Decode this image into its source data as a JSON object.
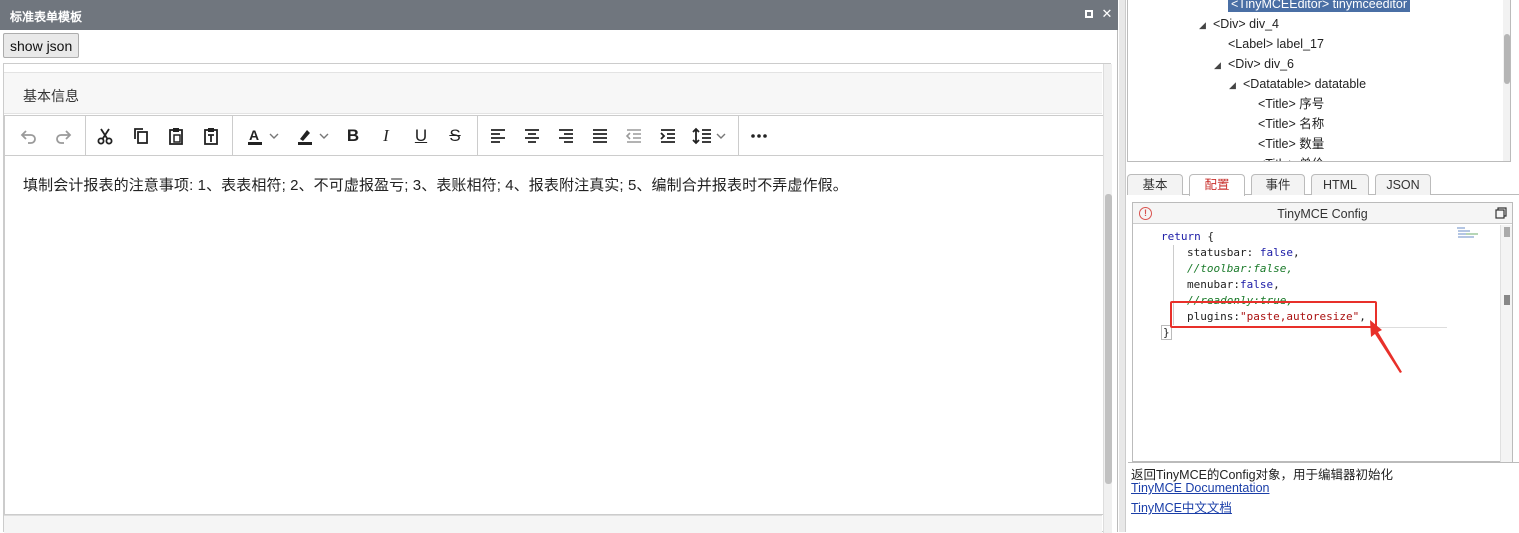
{
  "window": {
    "title": "标准表单模板",
    "maximize_icon": "maximize-icon",
    "close_label": "✕"
  },
  "toolbar_top": {
    "show_json_label": "show json"
  },
  "form": {
    "section_label": "基本信息",
    "editor": {
      "toolbar_icons": [
        "undo-icon",
        "redo-icon",
        "cut-icon",
        "copy-icon",
        "paste-icon",
        "paste-text-icon",
        "text-color-icon",
        "highlight-color-icon",
        "bold-icon",
        "italic-icon",
        "underline-icon",
        "strikethrough-icon",
        "align-left-icon",
        "align-center-icon",
        "align-right-icon",
        "justify-icon",
        "outdent-icon",
        "indent-icon",
        "line-height-icon",
        "more-icon"
      ],
      "bold_label": "B",
      "italic_label": "I",
      "underline_label": "U",
      "strike_label": "S",
      "text_color_label": "A",
      "content_text": "填制会计报表的注意事项: 1、表表相符; 2、不可虚报盈亏; 3、表账相符; 4、报表附注真实; 5、编制合并报表时不弄虚作假。"
    }
  },
  "tree": {
    "rows": [
      {
        "indent": 2,
        "twisty": "",
        "text": "<TinyMCEEditor> tinymceeditor",
        "selected": true
      },
      {
        "indent": 1,
        "twisty": "◢",
        "text": "<Div> div_4",
        "selected": false
      },
      {
        "indent": 2,
        "twisty": "",
        "text": "<Label> label_17",
        "selected": false
      },
      {
        "indent": 2,
        "twisty": "◢",
        "text": "<Div> div_6",
        "selected": false
      },
      {
        "indent": 3,
        "twisty": "◢",
        "text": "<Datatable> datatable",
        "selected": false
      },
      {
        "indent": 4,
        "twisty": "",
        "text": "<Title> 序号",
        "selected": false
      },
      {
        "indent": 4,
        "twisty": "",
        "text": "<Title> 名称",
        "selected": false
      },
      {
        "indent": 4,
        "twisty": "",
        "text": "<Title> 数量",
        "selected": false
      },
      {
        "indent": 4,
        "twisty": "",
        "text": "<Title> 单价",
        "selected": false
      }
    ]
  },
  "tabs": [
    {
      "label": "基本",
      "active": false
    },
    {
      "label": "配置",
      "active": true
    },
    {
      "label": "事件",
      "active": false
    },
    {
      "label": "HTML",
      "active": false
    },
    {
      "label": "JSON",
      "active": false
    }
  ],
  "config_panel": {
    "title": "TinyMCE Config",
    "code": {
      "l1_kw": "return",
      "l1_rest": " {",
      "l2_key": "statusbar: ",
      "l2_val": "false",
      "l2_end": ",",
      "l3": "//toolbar:false,",
      "l4_key": "menubar:",
      "l4_val": "false",
      "l4_end": ",",
      "l5": "//readonly:true,",
      "l6_key": "plugins:",
      "l6_val": "\"paste,autoresize\"",
      "l6_end": ",",
      "l7": "}"
    },
    "description": "返回TinyMCE的Config对象，用于编辑器初始化",
    "links": [
      "TinyMCE Documentation",
      "TinyMCE中文文档"
    ]
  },
  "colors": {
    "titlebar": "#70767e",
    "selected_tree": "#4a6fa5",
    "active_tab_text": "#c9302c",
    "annotation_red": "#e8302a",
    "link": "#1a3ea8"
  }
}
